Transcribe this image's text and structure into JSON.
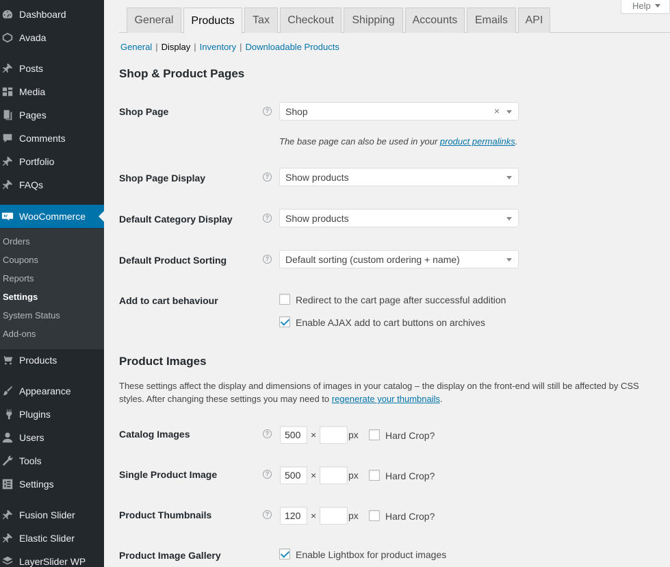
{
  "sidebar": {
    "items": [
      {
        "label": "Dashboard",
        "icon": "dashboard-icon"
      },
      {
        "label": "Avada",
        "icon": "avada-icon"
      },
      {
        "label": "Posts",
        "icon": "pin-icon"
      },
      {
        "label": "Media",
        "icon": "media-icon"
      },
      {
        "label": "Pages",
        "icon": "pages-icon"
      },
      {
        "label": "Comments",
        "icon": "comment-icon"
      },
      {
        "label": "Portfolio",
        "icon": "pin-icon"
      },
      {
        "label": "FAQs",
        "icon": "pin-icon"
      },
      {
        "label": "WooCommerce",
        "icon": "woo-icon"
      },
      {
        "label": "Products",
        "icon": "cart-icon"
      },
      {
        "label": "Appearance",
        "icon": "brush-icon"
      },
      {
        "label": "Plugins",
        "icon": "plugin-icon"
      },
      {
        "label": "Users",
        "icon": "users-icon"
      },
      {
        "label": "Tools",
        "icon": "wrench-icon"
      },
      {
        "label": "Settings",
        "icon": "settings-icon"
      },
      {
        "label": "Fusion Slider",
        "icon": "pin-icon"
      },
      {
        "label": "Elastic Slider",
        "icon": "pin-icon"
      },
      {
        "label": "LayerSlider WP",
        "icon": "layers-icon"
      }
    ],
    "submenu": [
      "Orders",
      "Coupons",
      "Reports",
      "Settings",
      "System Status",
      "Add-ons"
    ]
  },
  "help": {
    "label": "Help"
  },
  "tabs": [
    "General",
    "Products",
    "Tax",
    "Checkout",
    "Shipping",
    "Accounts",
    "Emails",
    "API"
  ],
  "subnav": {
    "general": "General",
    "display": "Display",
    "inventory": "Inventory",
    "downloadable": "Downloadable Products",
    "sep": "|"
  },
  "shop_section": {
    "title": "Shop & Product Pages",
    "shop_page": {
      "label": "Shop Page",
      "value": "Shop",
      "clear": "×"
    },
    "shop_desc_pre": "The base page can also be used in your ",
    "shop_desc_link": "product permalinks",
    "shop_desc_post": ".",
    "shop_page_display": {
      "label": "Shop Page Display",
      "value": "Show products"
    },
    "default_category_display": {
      "label": "Default Category Display",
      "value": "Show products"
    },
    "default_sorting": {
      "label": "Default Product Sorting",
      "value": "Default sorting (custom ordering + name)"
    },
    "add_to_cart": {
      "label": "Add to cart behaviour",
      "redirect": {
        "label": "Redirect to the cart page after successful addition",
        "checked": false
      },
      "ajax": {
        "label": "Enable AJAX add to cart buttons on archives",
        "checked": true
      }
    }
  },
  "images_section": {
    "title": "Product Images",
    "desc_pre": "These settings affect the display and dimensions of images in your catalog – the display on the front-end will still be affected by CSS styles. After changing these settings you may need to ",
    "desc_link": "regenerate your thumbnails",
    "desc_post": ".",
    "times": "×",
    "px": "px",
    "hard_crop": "Hard Crop?",
    "catalog": {
      "label": "Catalog Images",
      "width": "500",
      "height": ""
    },
    "single": {
      "label": "Single Product Image",
      "width": "500",
      "height": ""
    },
    "thumbs": {
      "label": "Product Thumbnails",
      "width": "120",
      "height": ""
    },
    "gallery": {
      "label": "Product Image Gallery",
      "lightbox": "Enable Lightbox for product images"
    }
  },
  "help_glyph": "?"
}
